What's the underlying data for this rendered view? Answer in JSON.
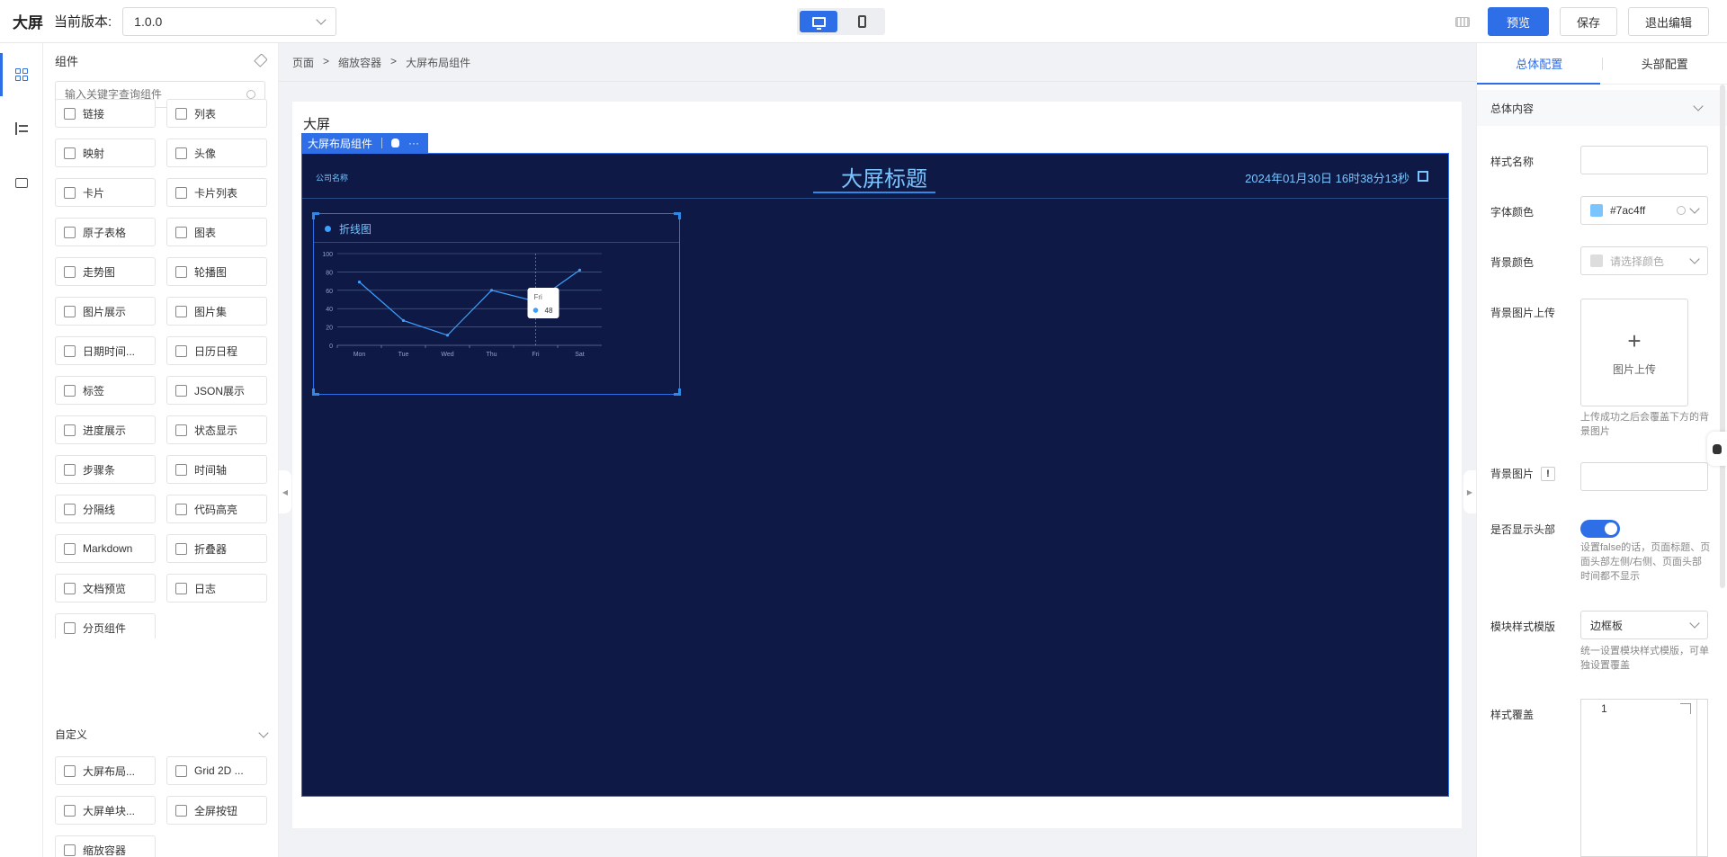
{
  "topbar": {
    "app_title": "大屏",
    "version_label": "当前版本:",
    "version_value": "1.0.0",
    "preview": "预览",
    "save": "保存",
    "exit": "退出编辑"
  },
  "components": {
    "header": "组件",
    "search_placeholder": "输入关键字查询组件",
    "items": [
      "链接",
      "列表",
      "映射",
      "头像",
      "卡片",
      "卡片列表",
      "原子表格",
      "图表",
      "走势图",
      "轮播图",
      "图片展示",
      "图片集",
      "日期时间...",
      "日历日程",
      "标签",
      "JSON展示",
      "进度展示",
      "状态显示",
      "步骤条",
      "时间轴",
      "分隔线",
      "代码高亮",
      "Markdown",
      "折叠器",
      "文档预览",
      "日志",
      "分页组件"
    ],
    "custom_header": "自定义",
    "custom_items": [
      "大屏布局...",
      "Grid 2D ...",
      "大屏单块...",
      "全屏按钮",
      "缩放容器"
    ]
  },
  "breadcrumb": [
    "页面",
    ">",
    "缩放容器",
    ">",
    "大屏布局组件"
  ],
  "canvas": {
    "page_title": "大屏",
    "component_tag": "大屏布局组件",
    "tag_more": "···",
    "company": "公司名称",
    "big_title": "大屏标题",
    "datetime": "2024年01月30日 16时38分13秒",
    "chart_title": "折线图"
  },
  "chart_data": {
    "type": "line",
    "categories": [
      "Mon",
      "Tue",
      "Wed",
      "Thu",
      "Fri",
      "Sat"
    ],
    "values": [
      69,
      27,
      11,
      60,
      48,
      82
    ],
    "ylim": [
      0,
      100
    ],
    "yticks": [
      "0",
      "20",
      "40",
      "60",
      "80",
      "100"
    ],
    "grid": true,
    "tooltip": {
      "category": "Fri",
      "value": "48"
    },
    "line_color": "#3ba0ff"
  },
  "config": {
    "tab_global": "总体配置",
    "tab_header": "头部配置",
    "section": "总体内容",
    "style_name_label": "样式名称",
    "font_color_label": "字体颜色",
    "font_color_value": "#7ac4ff",
    "bg_color_label": "背景颜色",
    "bg_color_placeholder": "请选择颜色",
    "bg_image_upload_label": "背景图片上传",
    "upload_text": "图片上传",
    "upload_hint": "上传成功之后会覆盖下方的背景图片",
    "bg_image_label": "背景图片",
    "bg_image_warn": "!",
    "show_header_label": "是否显示头部",
    "show_header_hint": "设置false的话，页面标题、页面头部左侧/右侧、页面头部时间都不显示",
    "module_style_label": "模块样式模版",
    "module_style_value": "边框板",
    "module_style_hint": "统一设置模块样式模版，可单独设置覆盖",
    "style_override_label": "样式覆盖",
    "editor_line": "1"
  }
}
